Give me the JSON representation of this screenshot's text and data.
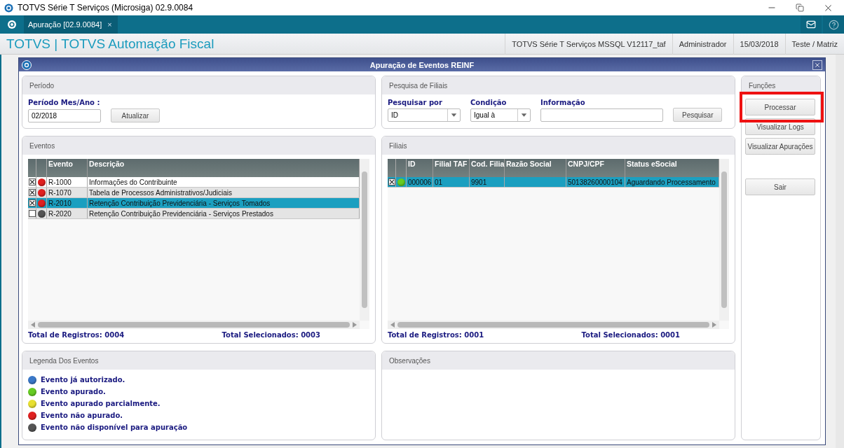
{
  "os_window": {
    "title": "TOTVS Série T Serviços (Microsiga) 02.9.0084"
  },
  "app_tabs": [
    {
      "label": "Apuração [02.9.0084]",
      "close": "×",
      "selected": true
    }
  ],
  "header": {
    "title": "TOTVS | TOTVS Automação Fiscal",
    "info": [
      "TOTVS Série T Serviços MSSQL V12117_taf",
      "Administrador",
      "15/03/2018",
      "Teste / Matriz"
    ]
  },
  "dialog": {
    "title": "Apuração de Eventos REINF"
  },
  "periodo": {
    "title": "Período",
    "label": "Período Mes/Ano :",
    "value": "02/2018",
    "button": "Atualizar"
  },
  "pesquisa": {
    "title": "Pesquisa de Filiais",
    "fields": [
      {
        "kind": "select",
        "label": "Pesquisar por",
        "value": "ID"
      },
      {
        "kind": "select",
        "label": "Condição",
        "value": "Igual à"
      },
      {
        "kind": "input",
        "label": "Informação"
      }
    ],
    "button": "Pesquisar"
  },
  "eventos": {
    "title": "Eventos",
    "columns": [
      "Evento",
      "Descrição"
    ],
    "rows": [
      {
        "checked": true,
        "color": "#e02020",
        "selected": false,
        "cells": [
          "R-1000",
          "Informações do Contribuinte"
        ]
      },
      {
        "checked": true,
        "color": "#e02020",
        "selected": false,
        "cells": [
          "R-1070",
          "Tabela de Processos Administrativos/Judiciais"
        ]
      },
      {
        "checked": true,
        "color": "#e02020",
        "selected": true,
        "cells": [
          "R-2010",
          "Retenção Contribuição Previdenciária - Serviços Tomados"
        ]
      },
      {
        "checked": false,
        "color": "#555555",
        "selected": false,
        "cells": [
          "R-2020",
          "Retenção Contribuição Previdenciária - Serviços Prestados"
        ]
      }
    ],
    "total_registros": "Total de Registros: 0004",
    "total_selecionados": "Total Selecionados: 0003"
  },
  "filiais": {
    "title": "Filiais",
    "columns": [
      "ID",
      "Filial TAF",
      "Cod. Filia",
      "Razão Social",
      "CNPJ/CPF",
      "Status eSocial"
    ],
    "rows": [
      {
        "checked": true,
        "color": "#66cc22",
        "selected": true,
        "cells": [
          "000006",
          "01",
          "9901",
          "",
          "50138260000104",
          "Aguardando Processamento"
        ]
      }
    ],
    "total_registros": "Total de Registros: 0001",
    "total_selecionados": "Total Selecionados: 0001"
  },
  "funcoes": {
    "title": "Funções",
    "buttons": [
      {
        "label": "Processar",
        "highlighted": true
      },
      {
        "label": "Visualizar Logs",
        "highlighted": false
      },
      {
        "label": "Visualizar Apurações",
        "highlighted": false
      }
    ],
    "exit_button": "Sair"
  },
  "legenda": {
    "title": "Legenda Dos Eventos",
    "items": [
      {
        "color": "#3a78c8",
        "label": "Evento já autorizado."
      },
      {
        "color": "#66cc22",
        "label": "Evento apurado."
      },
      {
        "color": "#e8e030",
        "label": "Evento apurado parcialmente."
      },
      {
        "color": "#e02020",
        "label": "Evento não apurado."
      },
      {
        "color": "#555555",
        "label": "Evento não disponível para apuração"
      }
    ]
  },
  "observacoes": {
    "title": "Observações"
  }
}
